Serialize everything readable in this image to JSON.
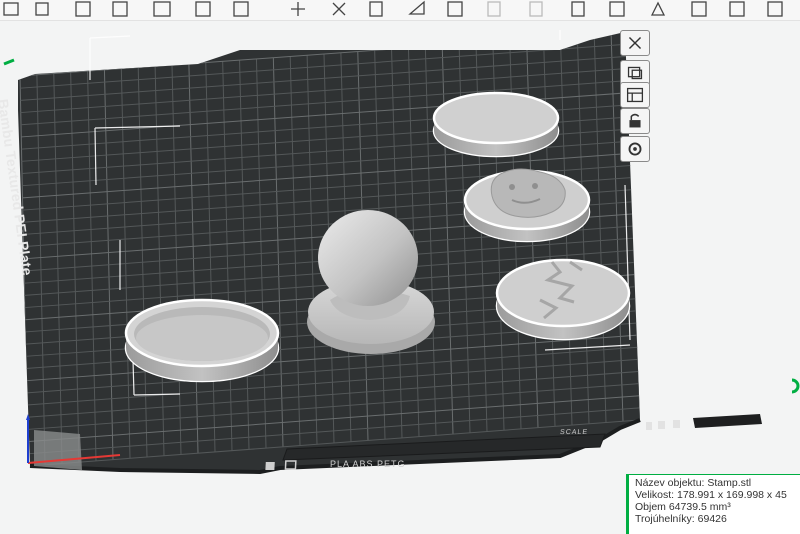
{
  "plate": {
    "name": "Bambu Textured PEI Plate",
    "filaments": "PLA ABS PETG",
    "scale_hint": "SCALE"
  },
  "object_info": {
    "name": "Název objektu: Stamp.stl",
    "size": "Velikost: 178.991 x 169.998 x 45",
    "volume": "Objem 64739.5 mm³",
    "triangles": "Trojúhelníky: 69426"
  },
  "plate_tools": [
    {
      "id": "delete",
      "icon": "close-x-icon"
    },
    {
      "id": "arrange",
      "icon": "arrange-icon"
    },
    {
      "id": "orient",
      "icon": "layout-icon"
    },
    {
      "id": "lock",
      "icon": "lock-icon"
    },
    {
      "id": "settings",
      "icon": "gear-icon"
    }
  ],
  "colors": {
    "bed": "#2f3233",
    "grid": "#545859",
    "accent": "#00ae42",
    "background": "#f3f4f4",
    "model": "#c9c9c9"
  }
}
